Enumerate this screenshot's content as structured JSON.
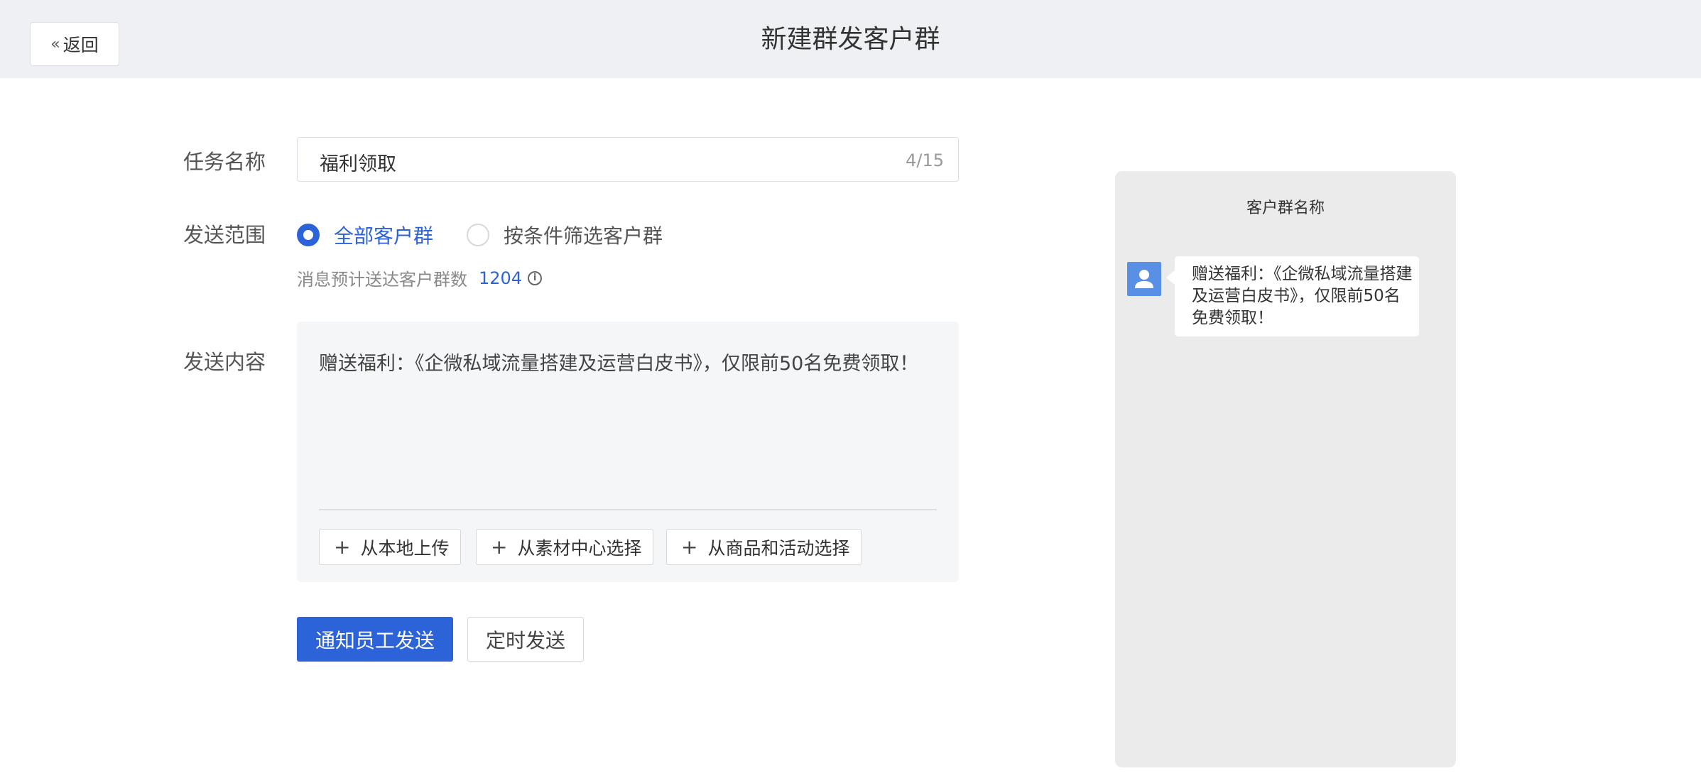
{
  "header": {
    "back_label": "返回",
    "title": "新建群发客户群"
  },
  "form": {
    "task_name": {
      "label": "任务名称",
      "value": "福利领取",
      "count": "4/15"
    },
    "send_scope": {
      "label": "发送范围",
      "options": [
        {
          "label": "全部客户群",
          "checked": true
        },
        {
          "label": "按条件筛选客户群",
          "checked": false
        }
      ],
      "estimate_label": "消息预计送达客户群数",
      "estimate_count": "1204"
    },
    "send_content": {
      "label": "发送内容",
      "text": "赠送福利：《企微私域流量搭建及运营白皮书》，仅限前50名免费领取！",
      "buttons": [
        "从本地上传",
        "从素材中心选择",
        "从商品和活动选择"
      ]
    },
    "actions": {
      "primary": "通知员工发送",
      "secondary": "定时发送"
    }
  },
  "preview": {
    "title": "客户群名称",
    "message": "赠送福利：《企微私域流量搭建及运营白皮书》，仅限前50名免费领取！"
  },
  "colors": {
    "accent": "#2d63d9",
    "header_bg": "#eef0f4",
    "content_bg": "#f5f6f8",
    "preview_bg": "#ebebeb"
  }
}
